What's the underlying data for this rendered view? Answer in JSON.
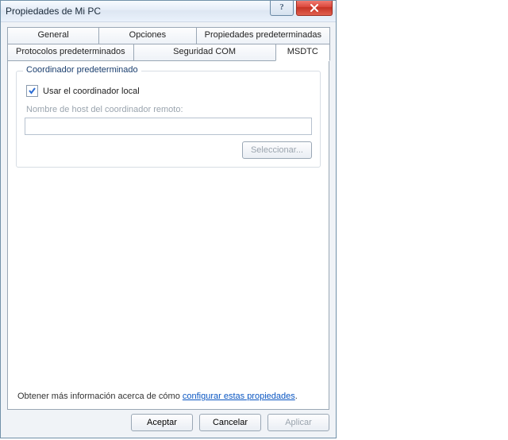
{
  "window": {
    "title": "Propiedades de Mi PC"
  },
  "tabs": {
    "row1": [
      {
        "label": "General"
      },
      {
        "label": "Opciones"
      },
      {
        "label": "Propiedades predeterminadas"
      }
    ],
    "row2": [
      {
        "label": "Protocolos predeterminados"
      },
      {
        "label": "Seguridad COM"
      },
      {
        "label": "MSDTC",
        "active": true
      }
    ]
  },
  "group": {
    "legend": "Coordinador predeterminado",
    "use_local_label": "Usar el coordinador local",
    "use_local_checked": true,
    "remote_host_label": "Nombre de host del coordinador remoto:",
    "remote_host_value": "",
    "browse_label": "Seleccionar..."
  },
  "info": {
    "prefix": "Obtener más información acerca de cómo ",
    "link": "configurar estas propiedades",
    "suffix": "."
  },
  "footer": {
    "ok": "Aceptar",
    "cancel": "Cancelar",
    "apply": "Aplicar"
  }
}
